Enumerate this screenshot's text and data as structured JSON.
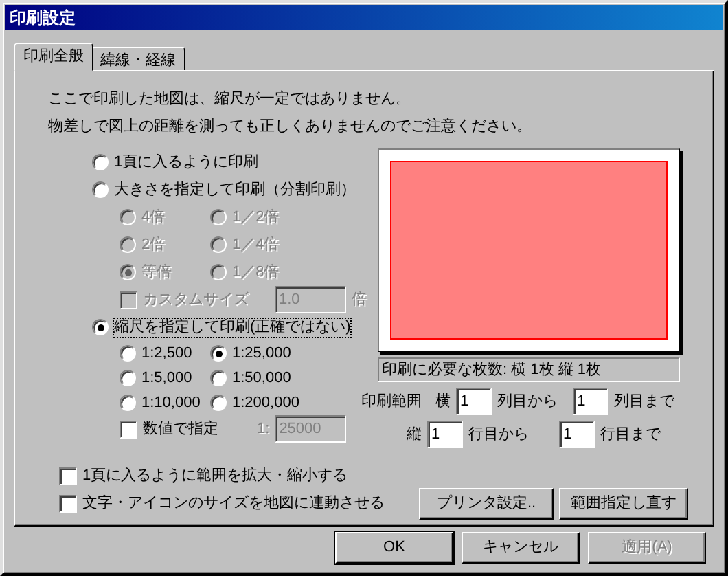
{
  "window": {
    "title": "印刷設定"
  },
  "tabs": [
    {
      "label": "印刷全般",
      "selected": true
    },
    {
      "label": "緯線・経線",
      "selected": false
    }
  ],
  "notice": [
    "ここで印刷した地図は、縮尺が一定ではありません。",
    "物差しで図上の距離を測っても正しくありませんのでご注意ください。"
  ],
  "print_modes": [
    {
      "label": "1頁に入るように印刷",
      "selected": false,
      "focused": false
    },
    {
      "label": "大きさを指定して印刷（分割印刷）",
      "selected": false,
      "focused": false
    },
    {
      "label": "縮尺を指定して印刷(正確ではない)",
      "selected": true,
      "focused": true
    }
  ],
  "size_options": [
    {
      "label": "4倍",
      "selected": false,
      "disabled": true
    },
    {
      "label": "1／2倍",
      "selected": false,
      "disabled": true
    },
    {
      "label": "2倍",
      "selected": false,
      "disabled": true
    },
    {
      "label": "1／4倍",
      "selected": false,
      "disabled": true
    },
    {
      "label": "等倍",
      "selected": true,
      "disabled": true
    },
    {
      "label": "1／8倍",
      "selected": false,
      "disabled": true
    }
  ],
  "custom_size": {
    "label": "カスタムサイズ",
    "checked": false,
    "disabled": true,
    "value": "1.0",
    "unit": "倍"
  },
  "scale_options": [
    {
      "label": "1:2,500",
      "selected": false
    },
    {
      "label": "1:25,000",
      "selected": true
    },
    {
      "label": "1:5,000",
      "selected": false
    },
    {
      "label": "1:50,000",
      "selected": false
    },
    {
      "label": "1:10,000",
      "selected": false
    },
    {
      "label": "1:200,000",
      "selected": false
    }
  ],
  "numeric_scale": {
    "label": "数値で指定",
    "checked": false,
    "prefix": "1:",
    "value": "25000",
    "field_disabled": true
  },
  "options": [
    {
      "label": "1頁に入るように範囲を拡大・縮小する",
      "checked": false
    },
    {
      "label": "文字・アイコンのサイズを地図に連動させる",
      "checked": false
    }
  ],
  "sheets_text": "印刷に必要な枚数: 横 1枚 縦 1枚",
  "range": {
    "label": "印刷範囲",
    "rows": [
      {
        "axis": "横",
        "from": "1",
        "from_suffix": "列目から",
        "to": "1",
        "to_suffix": "列目まで"
      },
      {
        "axis": "縦",
        "from": "1",
        "from_suffix": "行目から",
        "to": "1",
        "to_suffix": "行目まで"
      }
    ]
  },
  "panel_buttons": [
    "プリンタ設定..",
    "範囲指定し直す"
  ],
  "dialog_buttons": [
    {
      "label": "OK",
      "default": true,
      "disabled": false
    },
    {
      "label": "キャンセル",
      "default": false,
      "disabled": false
    },
    {
      "label": "適用(A)",
      "default": false,
      "disabled": true
    }
  ]
}
